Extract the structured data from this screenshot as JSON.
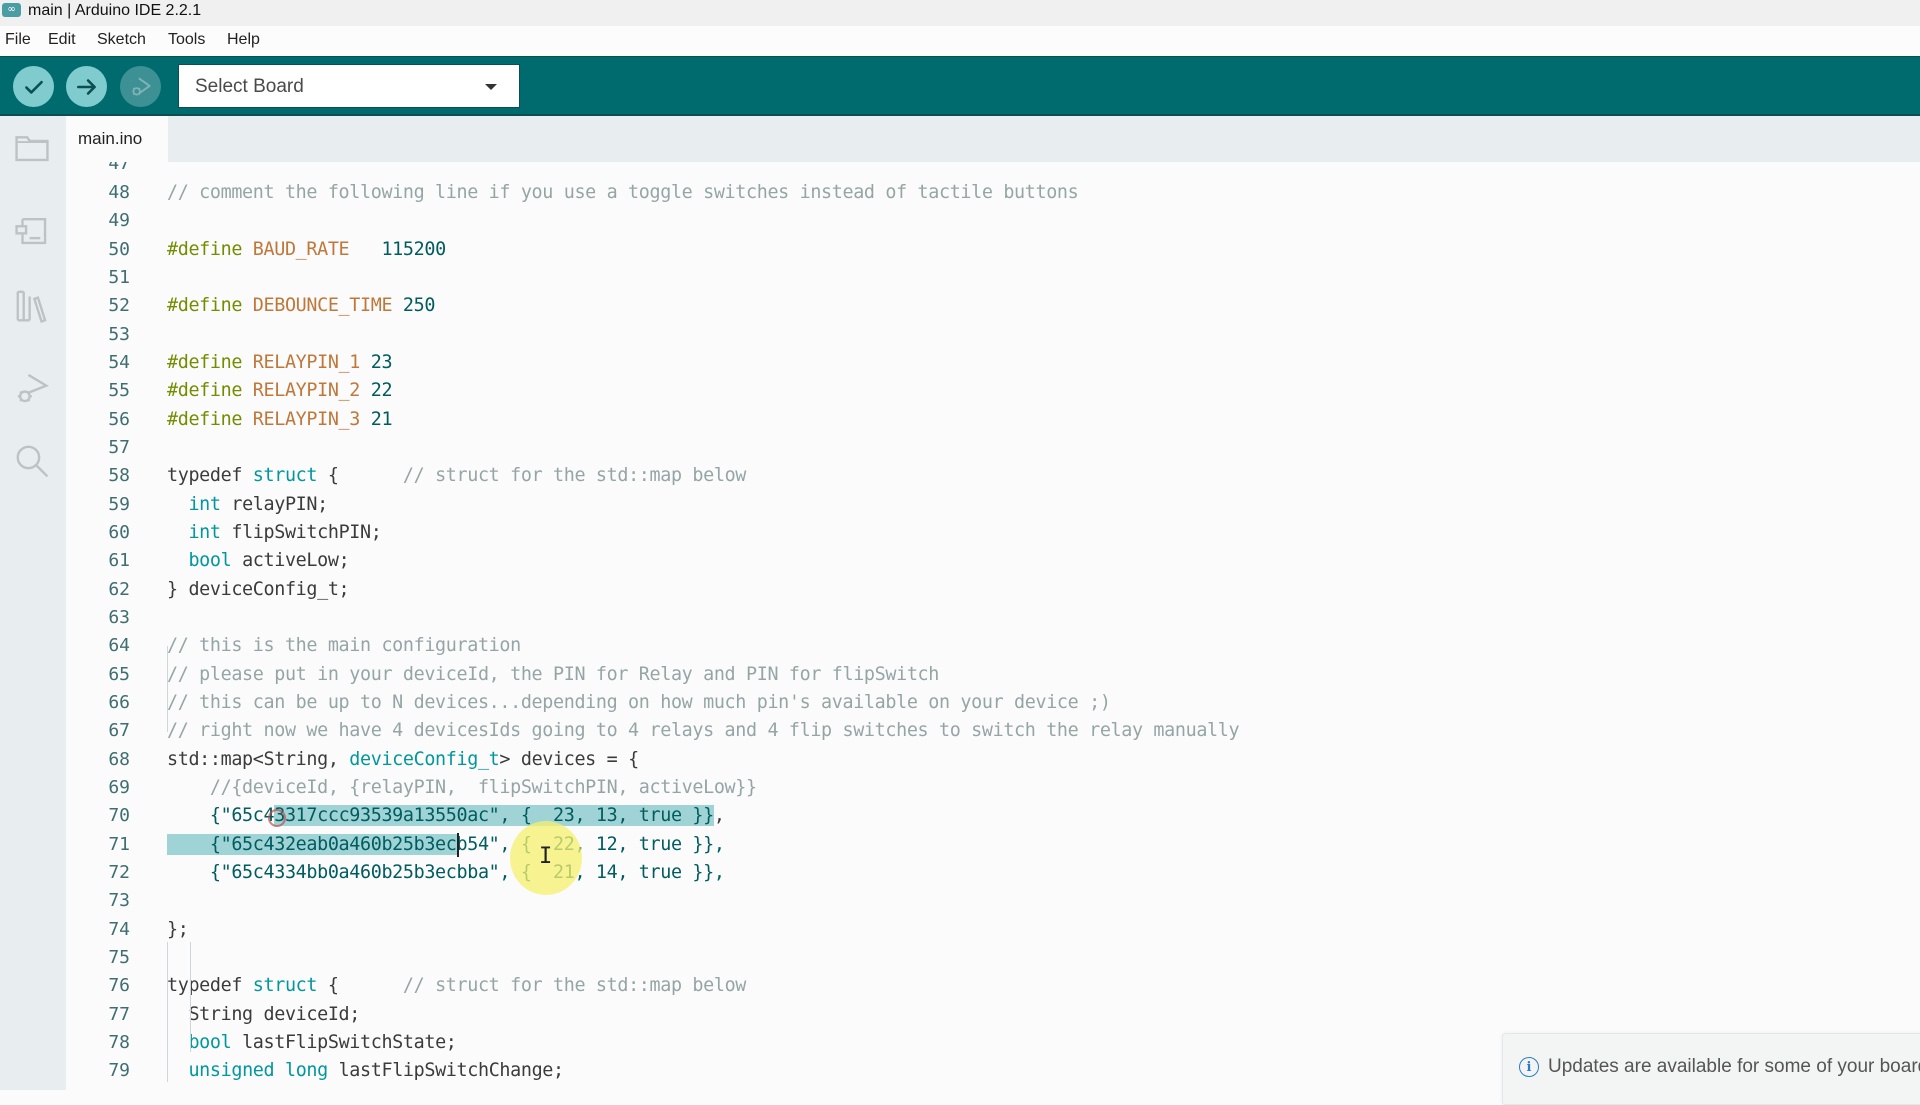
{
  "window": {
    "title": "main | Arduino IDE 2.2.1",
    "app_icon": "arduino-infinity-icon",
    "app_icon_glyph": "∞"
  },
  "menu": {
    "items": [
      {
        "label": "File"
      },
      {
        "label": "Edit"
      },
      {
        "label": "Sketch"
      },
      {
        "label": "Tools"
      },
      {
        "label": "Help"
      }
    ]
  },
  "toolbar": {
    "verify_icon": "check-icon",
    "upload_icon": "arrow-right-icon",
    "debug_icon": "debug-play-icon",
    "debug_enabled": false,
    "board_select": {
      "label": "Select Board",
      "icon": "caret-down-icon"
    }
  },
  "sidebar": {
    "items": [
      {
        "name": "sketchbook",
        "icon": "folder-icon"
      },
      {
        "name": "boards-manager",
        "icon": "board-icon"
      },
      {
        "name": "library-manager",
        "icon": "library-icon"
      },
      {
        "name": "debug",
        "icon": "debug-icon"
      },
      {
        "name": "search",
        "icon": "search-icon"
      }
    ]
  },
  "tabs": [
    {
      "label": "main.ino",
      "active": true
    }
  ],
  "editor": {
    "first_partial_line": "47",
    "lines": [
      {
        "n": "48",
        "tokens": [
          {
            "t": "// comment the following line if you use a toggle switches instead of tactile buttons",
            "c": "cmt"
          }
        ]
      },
      {
        "n": "49",
        "tokens": []
      },
      {
        "n": "50",
        "tokens": [
          {
            "t": "#define ",
            "c": "pp"
          },
          {
            "t": "BAUD_RATE",
            "c": "mac"
          },
          {
            "t": "   ",
            "c": ""
          },
          {
            "t": "115200",
            "c": "num"
          }
        ]
      },
      {
        "n": "51",
        "tokens": []
      },
      {
        "n": "52",
        "tokens": [
          {
            "t": "#define ",
            "c": "pp"
          },
          {
            "t": "DEBOUNCE_TIME",
            "c": "mac"
          },
          {
            "t": " ",
            "c": ""
          },
          {
            "t": "250",
            "c": "num"
          }
        ]
      },
      {
        "n": "53",
        "tokens": []
      },
      {
        "n": "54",
        "tokens": [
          {
            "t": "#define ",
            "c": "pp"
          },
          {
            "t": "RELAYPIN_1",
            "c": "mac"
          },
          {
            "t": " ",
            "c": ""
          },
          {
            "t": "23",
            "c": "num"
          }
        ]
      },
      {
        "n": "55",
        "tokens": [
          {
            "t": "#define ",
            "c": "pp"
          },
          {
            "t": "RELAYPIN_2",
            "c": "mac"
          },
          {
            "t": " ",
            "c": ""
          },
          {
            "t": "22",
            "c": "num"
          }
        ]
      },
      {
        "n": "56",
        "tokens": [
          {
            "t": "#define ",
            "c": "pp"
          },
          {
            "t": "RELAYPIN_3",
            "c": "mac"
          },
          {
            "t": " ",
            "c": ""
          },
          {
            "t": "21",
            "c": "num"
          }
        ]
      },
      {
        "n": "57",
        "tokens": []
      },
      {
        "n": "58",
        "tokens": [
          {
            "t": "typedef ",
            "c": ""
          },
          {
            "t": "struct",
            "c": "kw"
          },
          {
            "t": " {      ",
            "c": ""
          },
          {
            "t": "// struct for the std::map below",
            "c": "cmt"
          }
        ]
      },
      {
        "n": "59",
        "tokens": [
          {
            "t": "  ",
            "c": ""
          },
          {
            "t": "int",
            "c": "type"
          },
          {
            "t": " relayPIN;",
            "c": ""
          }
        ]
      },
      {
        "n": "60",
        "tokens": [
          {
            "t": "  ",
            "c": ""
          },
          {
            "t": "int",
            "c": "type"
          },
          {
            "t": " flipSwitchPIN;",
            "c": ""
          }
        ]
      },
      {
        "n": "61",
        "tokens": [
          {
            "t": "  ",
            "c": ""
          },
          {
            "t": "bool",
            "c": "type"
          },
          {
            "t": " activeLow;",
            "c": ""
          }
        ]
      },
      {
        "n": "62",
        "tokens": [
          {
            "t": "} deviceConfig_t;",
            "c": ""
          }
        ]
      },
      {
        "n": "63",
        "tokens": []
      },
      {
        "n": "64",
        "tokens": [
          {
            "t": "// this is the main configuration",
            "c": "cmt"
          }
        ]
      },
      {
        "n": "65",
        "tokens": [
          {
            "t": "// please put in your deviceId, the PIN for Relay and PIN for flipSwitch",
            "c": "cmt"
          }
        ]
      },
      {
        "n": "66",
        "tokens": [
          {
            "t": "// this can be up to N devices...depending on how much pin's available on your device ;)",
            "c": "cmt"
          }
        ]
      },
      {
        "n": "67",
        "tokens": [
          {
            "t": "// right now we have 4 devicesIds going to 4 relays and 4 flip switches to switch the relay manually",
            "c": "cmt"
          }
        ]
      },
      {
        "n": "68",
        "tokens": [
          {
            "t": "std::map<String, ",
            "c": ""
          },
          {
            "t": "deviceConfig_t",
            "c": "type"
          },
          {
            "t": "> devices = {",
            "c": ""
          }
        ]
      },
      {
        "n": "69",
        "tokens": [
          {
            "t": "    ",
            "c": ""
          },
          {
            "t": "//{deviceId, {relayPIN,  flipSwitchPIN, activeLow}}",
            "c": "cmt"
          }
        ]
      },
      {
        "n": "70",
        "tokens": [
          {
            "t": "    {\"65c4",
            "c": "str"
          },
          {
            "t": "3317ccc93539a13550ac\", {  23, 13, true }}",
            "c": "str",
            "sel": true
          },
          {
            "t": ",",
            "c": ""
          }
        ]
      },
      {
        "n": "71",
        "tokens": [
          {
            "t": "    {\"65c432eab0a460b25b3ec",
            "c": "str",
            "sel": true
          },
          {
            "t": "b54\", {  22, 12, true }},",
            "c": "str"
          }
        ]
      },
      {
        "n": "72",
        "tokens": [
          {
            "t": "    {\"65c4334bb0a460b25b3ecbba\", {  21, 14, true }},",
            "c": "str"
          }
        ]
      },
      {
        "n": "73",
        "tokens": []
      },
      {
        "n": "74",
        "tokens": [
          {
            "t": "};",
            "c": ""
          }
        ]
      },
      {
        "n": "75",
        "tokens": []
      },
      {
        "n": "76",
        "tokens": [
          {
            "t": "typedef ",
            "c": ""
          },
          {
            "t": "struct",
            "c": "kw"
          },
          {
            "t": " {      ",
            "c": ""
          },
          {
            "t": "// struct for the std::map below",
            "c": "cmt"
          }
        ]
      },
      {
        "n": "77",
        "tokens": [
          {
            "t": "  String deviceId;",
            "c": ""
          }
        ]
      },
      {
        "n": "78",
        "tokens": [
          {
            "t": "  ",
            "c": ""
          },
          {
            "t": "bool",
            "c": "type"
          },
          {
            "t": " lastFlipSwitchState;",
            "c": ""
          }
        ]
      },
      {
        "n": "79",
        "tokens": [
          {
            "t": "  ",
            "c": ""
          },
          {
            "t": "unsigned",
            "c": "type"
          },
          {
            "t": " ",
            "c": ""
          },
          {
            "t": "long",
            "c": "type"
          },
          {
            "t": " lastFlipSwitchChange;",
            "c": ""
          }
        ]
      }
    ]
  },
  "notification": {
    "icon": "info-icon",
    "icon_glyph": "i",
    "message": "Updates are available for some of your boards and libraries."
  },
  "colors": {
    "toolbar": "#006b6e",
    "button": "#7fcbcd",
    "selection": "#9fd3d5",
    "keyword": "#00979d",
    "comment": "#95a5a6",
    "preprocessor": "#728e00",
    "macro": "#c0783a"
  }
}
